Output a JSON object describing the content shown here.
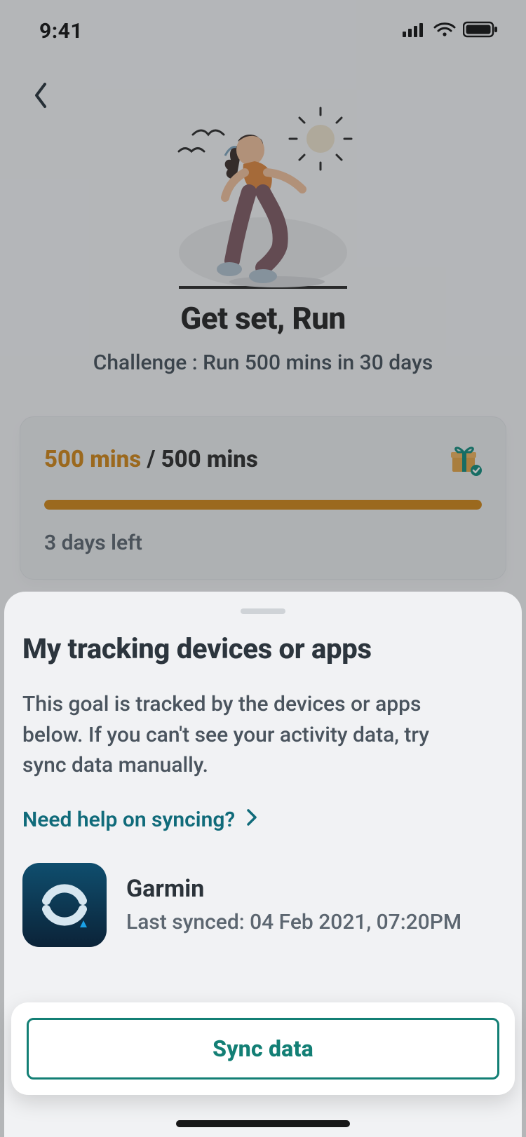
{
  "status": {
    "time": "9:41"
  },
  "header": {
    "title": "Get set, Run",
    "subtitle": "Challenge : Run 500 mins in 30 days"
  },
  "progress": {
    "done_label": "500 mins",
    "total_label": "/ 500 mins",
    "percent": 100,
    "days_left": "3 days left"
  },
  "sheet": {
    "title": "My tracking devices or apps",
    "description": "This goal is tracked by the devices or apps below. If you can't see your activity data, try sync data manually.",
    "help_link": "Need help on syncing?"
  },
  "device": {
    "name": "Garmin",
    "last_synced": "Last synced: 04 Feb 2021, 07:20PM"
  },
  "actions": {
    "sync_label": "Sync data"
  },
  "colors": {
    "accent_orange": "#d18617",
    "accent_teal": "#137f75",
    "link_teal": "#106b7a"
  }
}
